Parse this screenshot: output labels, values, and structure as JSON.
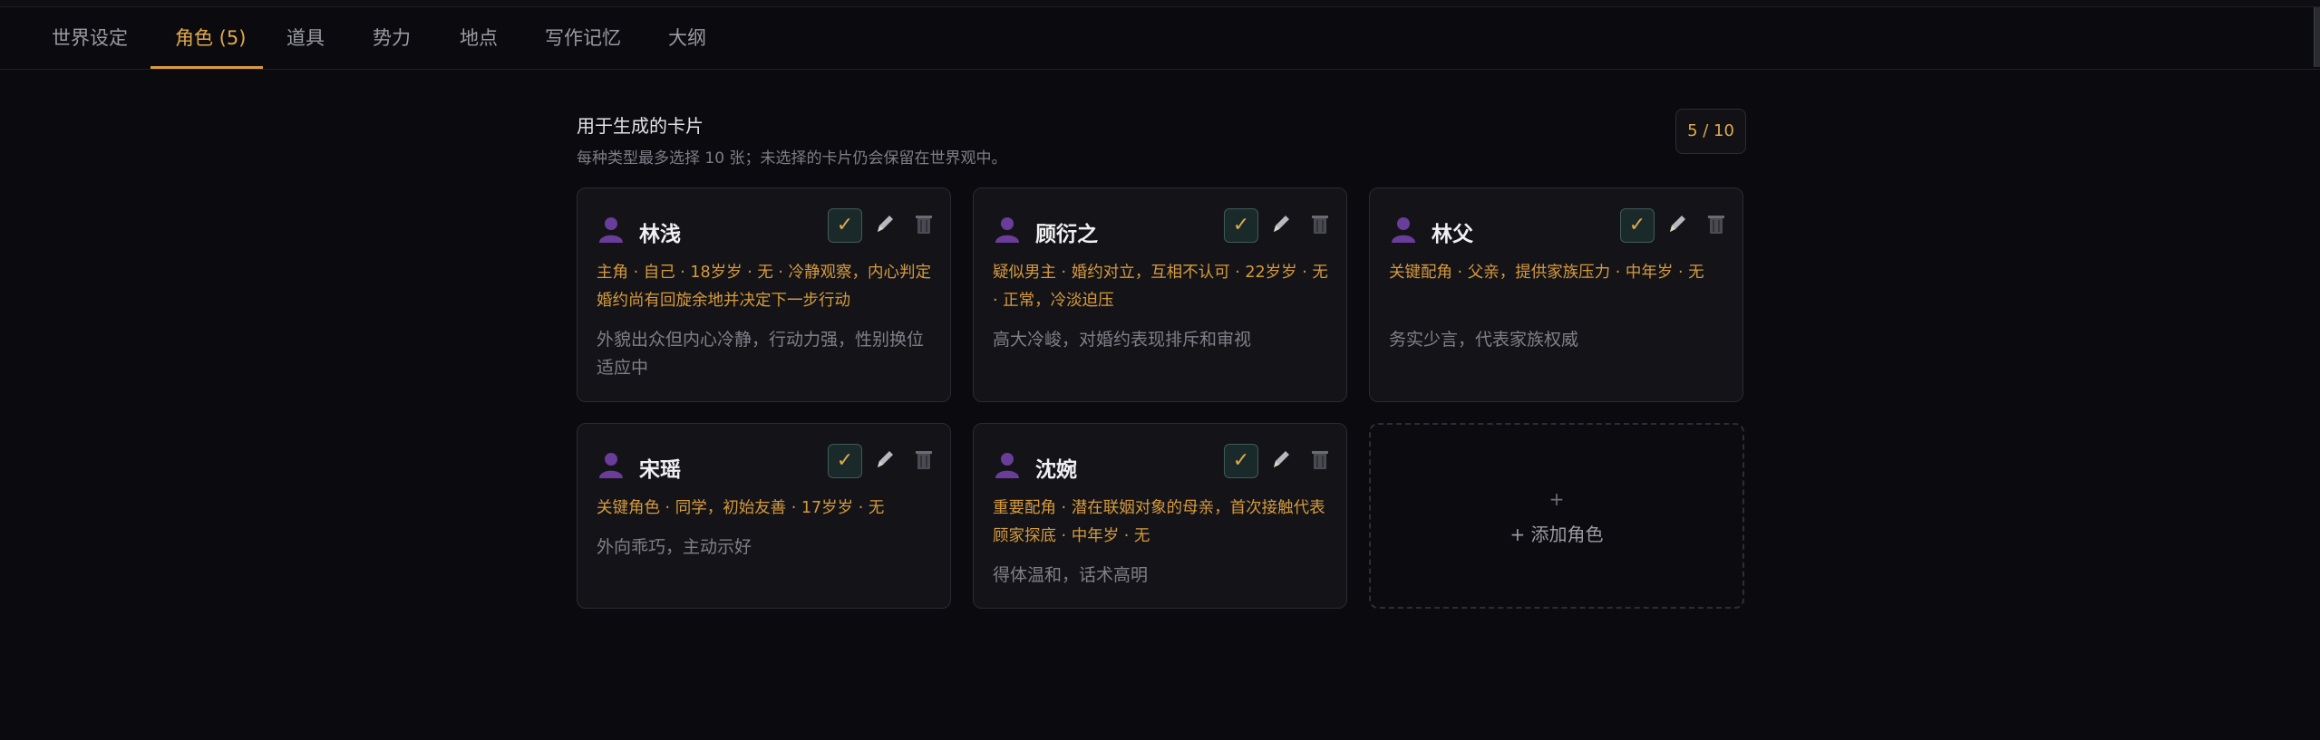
{
  "tabs": [
    {
      "label": "世界设定"
    },
    {
      "label": "角色 (5)"
    },
    {
      "label": "道具"
    },
    {
      "label": "势力"
    },
    {
      "label": "地点"
    },
    {
      "label": "写作记忆"
    },
    {
      "label": "大纲"
    }
  ],
  "active_tab_index": 1,
  "section": {
    "title": "用于生成的卡片",
    "subtitle": "每种类型最多选择 10 张；未选择的卡片仍会保留在世界观中。",
    "counter": "5 / 10"
  },
  "cards": [
    {
      "name": "林浅",
      "tags": "主角 · 自己 · 18岁岁 · 无 · 冷静观察，内心判定婚约尚有回旋余地并决定下一步行动",
      "desc": "外貌出众但内心冷静，行动力强，性别换位适应中",
      "selected": true
    },
    {
      "name": "顾衍之",
      "tags": "疑似男主 · 婚约对立，互相不认可 · 22岁岁 · 无 · 正常，冷淡迫压",
      "desc": "高大冷峻，对婚约表现排斥和审视",
      "selected": true
    },
    {
      "name": "林父",
      "tags": "关键配角 · 父亲，提供家族压力 · 中年岁 · 无",
      "desc": "务实少言，代表家族权威",
      "selected": true
    },
    {
      "name": "宋瑶",
      "tags": "关键角色 · 同学，初始友善 · 17岁岁 · 无",
      "desc": "外向乖巧，主动示好",
      "selected": true
    },
    {
      "name": "沈婉",
      "tags": "重要配角 · 潜在联姻对象的母亲，首次接触代表顾家探底 · 中年岁 · 无",
      "desc": "得体温和，话术高明",
      "selected": true
    }
  ],
  "add_card": {
    "plus": "+",
    "label": "+ 添加角色"
  },
  "icons": {
    "avatar": "person-icon",
    "check": "✓",
    "edit": "pencil-icon",
    "delete": "trash-icon"
  },
  "colors": {
    "accent": "#e0a94b",
    "background": "#0b0b0f",
    "card": "#141418",
    "avatar": "#6a3d9a"
  }
}
